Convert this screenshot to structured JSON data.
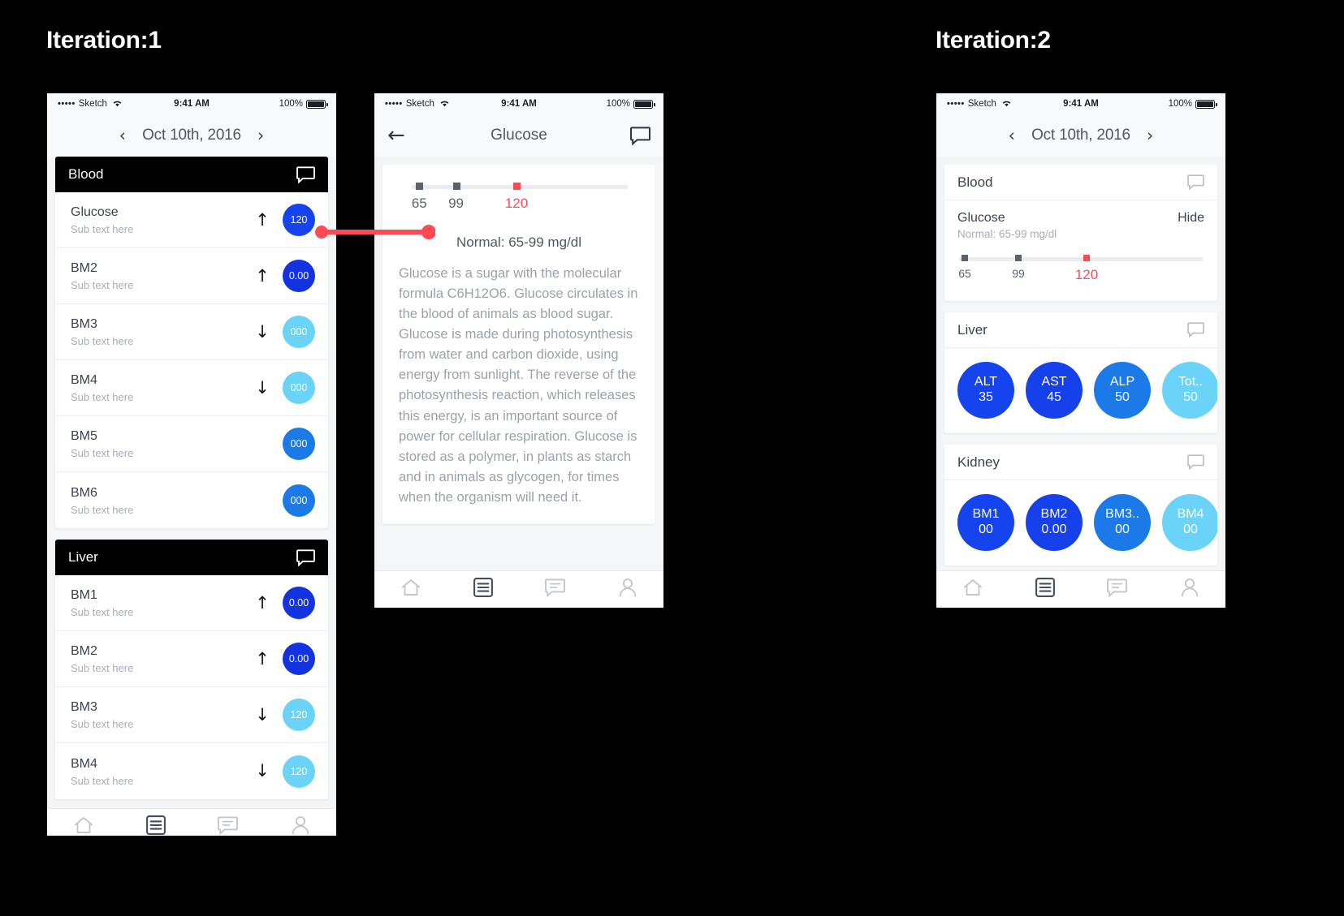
{
  "labels": {
    "iteration1": "Iteration:1",
    "iteration2": "Iteration:2"
  },
  "colors": {
    "accent_blue": "#1544ef",
    "mid_blue": "#1b7ae8",
    "light_blue": "#6ad3f7",
    "red": "#ff4a56",
    "black_header": "#000000",
    "text_dark": "#3c4350",
    "text_muted": "#a8adb6"
  },
  "statusbar": {
    "dots": "•••••",
    "carrier": "Sketch",
    "wifi_icon": "wifi-icon",
    "time": "9:41 AM",
    "battery_pct": "100%"
  },
  "phone1": {
    "datebar": {
      "prev_icon": "‹",
      "date": "Oct 10th, 2016",
      "next_icon": "›"
    },
    "groups": [
      {
        "title": "Blood",
        "chat_icon": "chat-bubble-icon",
        "rows": [
          {
            "title": "Glucose",
            "sub": "Sub text here",
            "arrow": "↑",
            "value": "120",
            "color": "#1544ef"
          },
          {
            "title": "BM2",
            "sub": "Sub text here",
            "arrow": "↑",
            "value": "0.00",
            "color": "#1333e0"
          },
          {
            "title": "BM3",
            "sub": "Sub text here",
            "arrow": "↓",
            "value": "000",
            "color": "#6ad3f7"
          },
          {
            "title": "BM4",
            "sub": "Sub text here",
            "arrow": "↓",
            "value": "000",
            "color": "#6ad3f7"
          },
          {
            "title": "BM5",
            "sub": "Sub text here",
            "arrow": "",
            "value": "000",
            "color": "#1b7ae8"
          },
          {
            "title": "BM6",
            "sub": "Sub text here",
            "arrow": "",
            "value": "000",
            "color": "#1b7ae8"
          }
        ]
      },
      {
        "title": "Liver",
        "chat_icon": "chat-bubble-icon",
        "rows": [
          {
            "title": "BM1",
            "sub": "Sub text here",
            "arrow": "↑",
            "value": "0.00",
            "color": "#1333e0"
          },
          {
            "title": "BM2",
            "sub": "Sub text here",
            "arrow": "↑",
            "value": "0.00",
            "color": "#1333e0"
          },
          {
            "title": "BM3",
            "sub": "Sub text here",
            "arrow": "↓",
            "value": "120",
            "color": "#6ad3f7"
          },
          {
            "title": "BM4",
            "sub": "Sub text here",
            "arrow": "↓",
            "value": "120",
            "color": "#6ad3f7"
          }
        ]
      }
    ],
    "tabbar": [
      {
        "icon": "home-icon",
        "active": false
      },
      {
        "icon": "list-icon",
        "active": true
      },
      {
        "icon": "chat-icon",
        "active": false
      },
      {
        "icon": "person-icon",
        "active": false
      }
    ]
  },
  "phone2": {
    "navbar": {
      "back_icon": "←",
      "title": "Glucose",
      "chat_icon": "chat-bubble-icon"
    },
    "meter": {
      "ticks": [
        {
          "label": "65",
          "pos_pct": 2,
          "color": "#5a6270"
        },
        {
          "label": "99",
          "pos_pct": 19,
          "color": "#5a6270"
        },
        {
          "label": "120",
          "pos_pct": 47,
          "color": "#ff4a56"
        }
      ]
    },
    "normal_range": "Normal: 65-99 mg/dl",
    "description": "Glucose is a sugar with the molecular formula C6H12O6. Glucose circulates in the blood of animals as blood sugar. Glucose is made during photosynthesis from water and carbon dioxide, using energy from sunlight. The reverse of the photosynthesis reaction, which releases this energy, is an important source of power for cellular respiration. Glucose is stored as a polymer, in plants as starch and in animals as glycogen, for times when the organism will need it.",
    "tabbar": [
      {
        "icon": "home-icon",
        "active": false
      },
      {
        "icon": "list-icon",
        "active": true
      },
      {
        "icon": "chat-icon",
        "active": false
      },
      {
        "icon": "person-icon",
        "active": false
      }
    ]
  },
  "phone3": {
    "datebar": {
      "prev_icon": "‹",
      "date": "Oct 10th, 2016",
      "next_icon": "›"
    },
    "cards": [
      {
        "title": "Blood",
        "chat_icon": "chat-bubble-icon",
        "kind": "meter",
        "item_name": "Glucose",
        "item_sub": "Normal: 65-99 mg/dl",
        "hide_label": "Hide",
        "ticks": [
          {
            "label": "65",
            "pos_pct": 1,
            "color": "#5a6270"
          },
          {
            "label": "99",
            "pos_pct": 23,
            "color": "#5a6270"
          },
          {
            "label": "120",
            "pos_pct": 51,
            "color": "#ff4a56"
          }
        ]
      },
      {
        "title": "Liver",
        "chat_icon": "chat-bubble-icon",
        "kind": "bubbles",
        "bubbles": [
          {
            "name": "ALT",
            "value": "35",
            "color": "#1544ef"
          },
          {
            "name": "AST",
            "value": "45",
            "color": "#1641ea"
          },
          {
            "name": "ALP",
            "value": "50",
            "color": "#1b7ae8"
          },
          {
            "name": "Tot..",
            "value": "50",
            "color": "#6ad3f7"
          }
        ]
      },
      {
        "title": "Kidney",
        "chat_icon": "chat-bubble-icon",
        "kind": "bubbles",
        "bubbles": [
          {
            "name": "BM1",
            "value": "00",
            "color": "#1544ef"
          },
          {
            "name": "BM2",
            "value": "0.00",
            "color": "#1641ea"
          },
          {
            "name": "BM3..",
            "value": "00",
            "color": "#1b7ae8"
          },
          {
            "name": "BM4",
            "value": "00",
            "color": "#6ad3f7"
          }
        ]
      }
    ],
    "tabbar": [
      {
        "icon": "home-icon",
        "active": false
      },
      {
        "icon": "list-icon",
        "active": true
      },
      {
        "icon": "chat-icon",
        "active": false
      },
      {
        "icon": "person-icon",
        "active": false
      }
    ]
  },
  "connector": {
    "color": "#ff4a56",
    "from": "glucose-badge",
    "to": "glucose-detail-card"
  }
}
